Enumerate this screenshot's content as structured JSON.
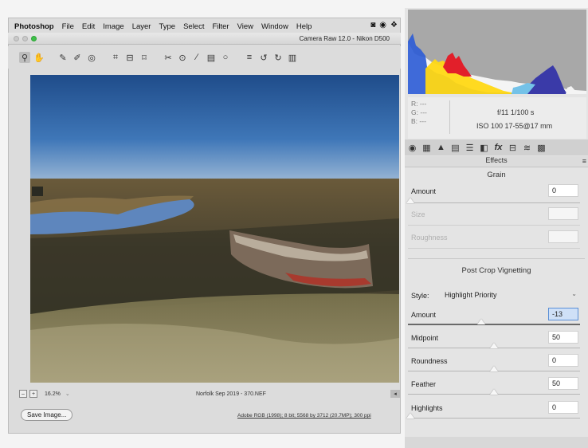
{
  "menubar": {
    "app": "Photoshop",
    "items": [
      "File",
      "Edit",
      "Image",
      "Layer",
      "Type",
      "Select",
      "Filter",
      "View",
      "Window",
      "Help"
    ]
  },
  "window": {
    "title": "Camera Raw 12.0  -  Nikon D500"
  },
  "bottom": {
    "zoom": "16.2%",
    "filename": "Norfolk Sep 2019 - 370.NEF",
    "save_label": "Save Image...",
    "workflow_link": "Adobe RGB (1998); 8 bit; 5568 by 3712 (20.7MP); 300 ppi"
  },
  "info": {
    "r_label": "R:",
    "g_label": "G:",
    "b_label": "B:",
    "r_val": "---",
    "g_val": "---",
    "b_val": "---",
    "aperture_shutter": "f/11   1/100 s",
    "iso_lens": "ISO 100   17-55@17 mm"
  },
  "panel": {
    "title": "Effects",
    "grain": {
      "title": "Grain",
      "amount_label": "Amount",
      "amount_value": "0",
      "size_label": "Size",
      "roughness_label": "Roughness"
    },
    "vignetting": {
      "title": "Post Crop Vignetting",
      "style_label": "Style:",
      "style_value": "Highlight Priority",
      "amount_label": "Amount",
      "amount_value": "-13",
      "midpoint_label": "Midpoint",
      "midpoint_value": "50",
      "roundness_label": "Roundness",
      "roundness_value": "0",
      "feather_label": "Feather",
      "feather_value": "50",
      "highlights_label": "Highlights",
      "highlights_value": "0"
    }
  },
  "colors": {
    "accent": "#5b8fd6",
    "panel_bg": "#e4e4e4",
    "histogram_bg": "#a8a8a8"
  },
  "icons": [
    "zoom-tool-icon",
    "hand-tool-icon",
    "white-balance-icon",
    "color-sampler-icon",
    "targeted-adjustment-icon",
    "crop-icon",
    "straighten-icon",
    "transform-icon",
    "spot-removal-icon",
    "red-eye-icon",
    "adjustment-brush-icon",
    "graduated-filter-icon",
    "radial-filter-icon",
    "preferences-icon",
    "rotate-ccw-icon",
    "rotate-cw-icon",
    "trash-icon"
  ]
}
